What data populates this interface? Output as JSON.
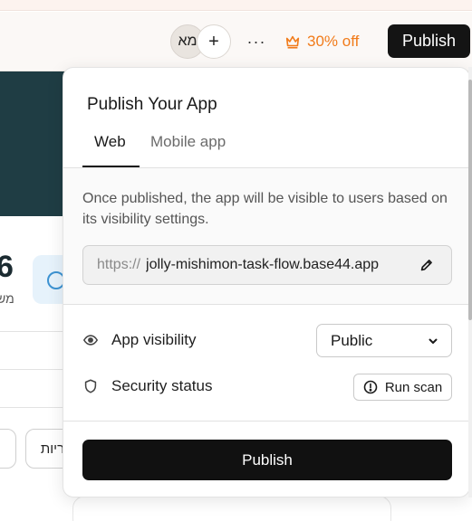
{
  "header": {
    "avatar_text": "מא",
    "promo_label": "30% off",
    "publish_label": "Publish",
    "accent_color": "#f17b1a"
  },
  "background": {
    "stat_number": "6",
    "stat_sub": "מש",
    "pill_text": "ריות"
  },
  "popover": {
    "title": "Publish Your App",
    "tabs": [
      {
        "label": "Web",
        "active": true
      },
      {
        "label": "Mobile app",
        "active": false
      }
    ],
    "description": "Once published, the app will be visible to users based on its visibility settings.",
    "url_prefix": "https://",
    "url_value": "jolly-mishimon-task-flow.base44.app",
    "visibility_label": "App visibility",
    "visibility_value": "Public",
    "security_label": "Security status",
    "scan_label": "Run scan",
    "publish_button": "Publish"
  },
  "icons": [
    "eye-icon",
    "shield-icon",
    "alert-circle-icon",
    "pencil-icon",
    "chevron-down-icon",
    "crown-icon",
    "plus-icon",
    "more-icon"
  ]
}
